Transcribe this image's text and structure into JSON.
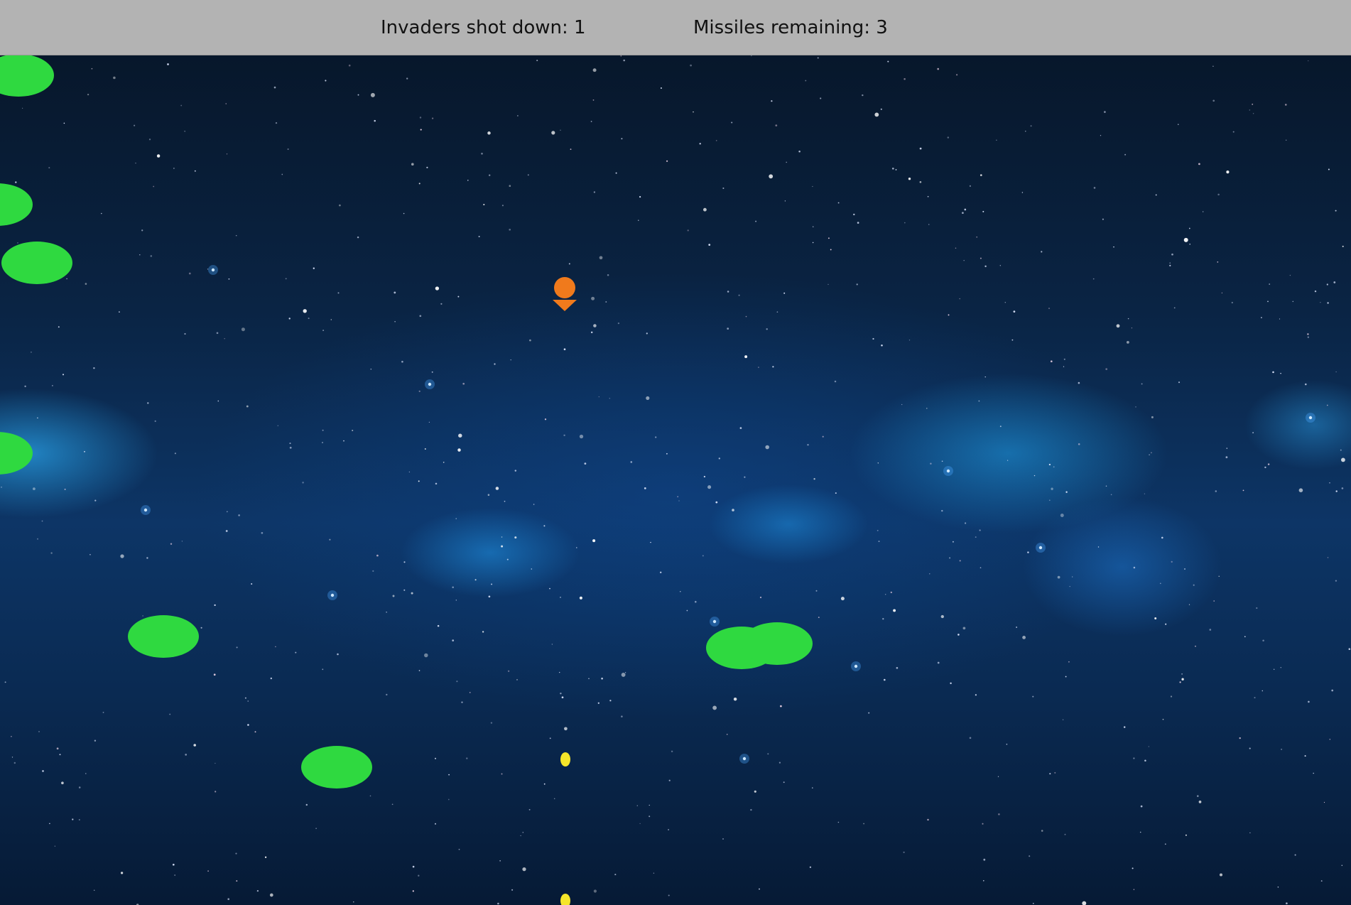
{
  "hud": {
    "kills_text": "Invaders shot down: 1",
    "missiles_text": "Missiles remaining: 3",
    "background_color": "#b3b3b3"
  },
  "game": {
    "invaders_shot_down": 1,
    "missiles_remaining": 3,
    "invader_color": "#2fd940",
    "player_color": "#f07a1c",
    "missile_color": "#f6e62a"
  }
}
